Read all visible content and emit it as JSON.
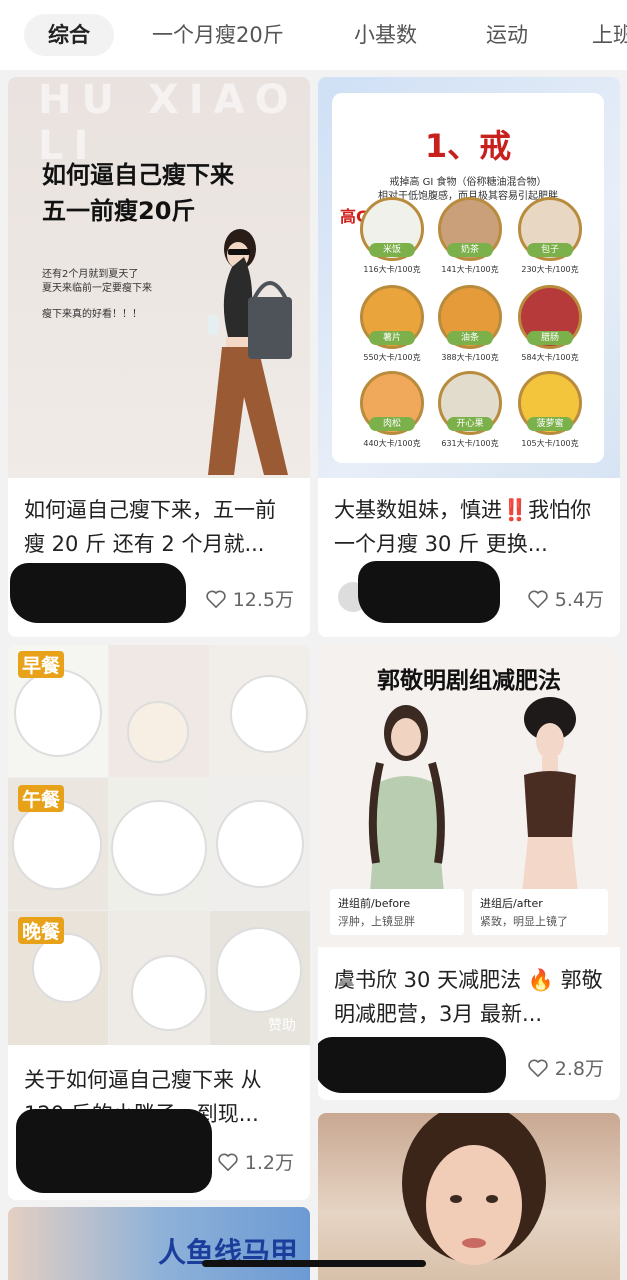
{
  "tabs": [
    {
      "label": "综合",
      "active": true
    },
    {
      "label": "一个月瘦20斤",
      "active": false
    },
    {
      "label": "小基数",
      "active": false
    },
    {
      "label": "运动",
      "active": false
    },
    {
      "label": "上班",
      "active": false
    }
  ],
  "cards": [
    {
      "title": "如何逼自己瘦下来，五一前瘦 20 斤 还有 2 个月就...",
      "likes": "12.5万",
      "image_text": {
        "watermark": "HU XIAO LI",
        "headline_1": "如何逼自己瘦下来",
        "headline_2": "五一前瘦20斤",
        "line_1": "还有2个月就到夏天了",
        "line_2": "夏天来临前一定要瘦下来",
        "line_3": "瘦下来真的好看！！！"
      }
    },
    {
      "title": "大基数姐妹，慎进‼️我怕你一个月瘦 30 斤 更换...",
      "likes": "5.4万",
      "image_text": {
        "big": "1、戒",
        "sub_1": "戒掉高 GI 食物（俗称糖油混合物）",
        "sub_2": "相对于低饱腹感，而且极其容易引起肥胖",
        "gi": "高GI",
        "foods": [
          {
            "name": "米饭",
            "cal": "116大卡/100克"
          },
          {
            "name": "奶茶",
            "cal": "141大卡/100克"
          },
          {
            "name": "包子",
            "cal": "230大卡/100克"
          },
          {
            "name": "薯片",
            "cal": "550大卡/100克"
          },
          {
            "name": "油条",
            "cal": "388大卡/100克"
          },
          {
            "name": "腊肠",
            "cal": "584大卡/100克"
          },
          {
            "name": "肉松",
            "cal": "440大卡/100克"
          },
          {
            "name": "开心果",
            "cal": "631大卡/100克"
          },
          {
            "name": "菠萝蜜",
            "cal": "105大卡/100克"
          }
        ]
      }
    },
    {
      "title": "关于如何逼自己瘦下来 从 120 斤的小胖子，到现...",
      "likes": "1.2万",
      "image_text": {
        "breakfast": "早餐",
        "lunch": "午餐",
        "dinner": "晚餐",
        "sponsor": "赞助"
      }
    },
    {
      "title": "虞书欣 30 天减肥法 🔥 郭敬明减肥营，3月 最新...",
      "likes": "2.8万",
      "image_text": {
        "headline": "郭敬明剧组减肥法",
        "before_label": "进组前/before",
        "before_desc": "浮肿，上镜显胖",
        "after_label": "进组后/after",
        "after_desc": "紧致，明显上镜了"
      }
    },
    {
      "image_text": {
        "headline": "人鱼线马甲"
      }
    }
  ]
}
